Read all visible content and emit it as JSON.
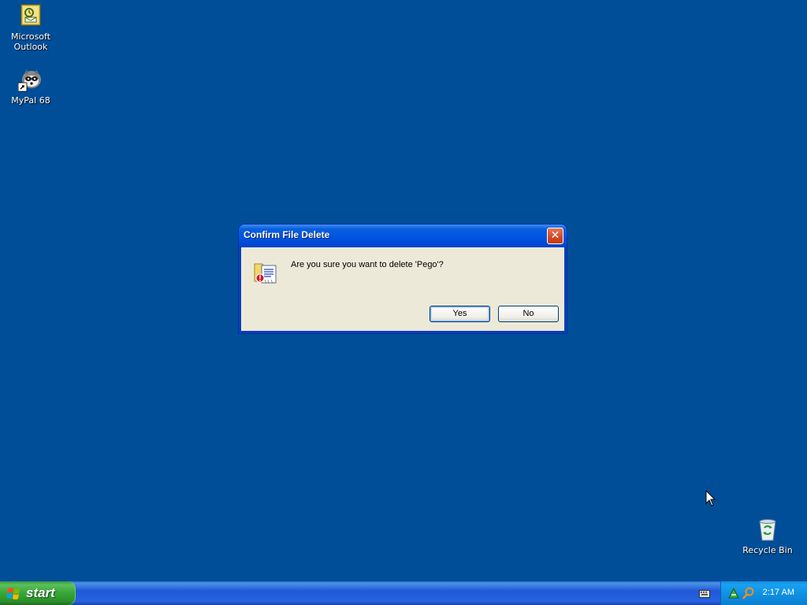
{
  "desktop": {
    "background_color": "#004e98",
    "icons": [
      {
        "label": "Microsoft\nOutlook",
        "label_line1": "Microsoft",
        "label_line2": "Outlook",
        "icon": "outlook-icon"
      },
      {
        "label_line1": "MyPal 68",
        "icon": "mypal-raccoon-icon"
      },
      {
        "label_line1": "Recycle Bin",
        "icon": "recycle-bin-icon"
      }
    ]
  },
  "dialog": {
    "title": "Confirm File Delete",
    "close_label": "✕",
    "message": "Are you sure you want to delete 'Pego'?",
    "icon": "delete-folder-warning-icon",
    "yes_label": "Yes",
    "no_label": "No"
  },
  "taskbar": {
    "start_label": "start",
    "clock": "2:17 AM",
    "tray_icons": [
      "network-icon",
      "search-icon"
    ],
    "keyboard_icon": "keyboard-icon"
  }
}
